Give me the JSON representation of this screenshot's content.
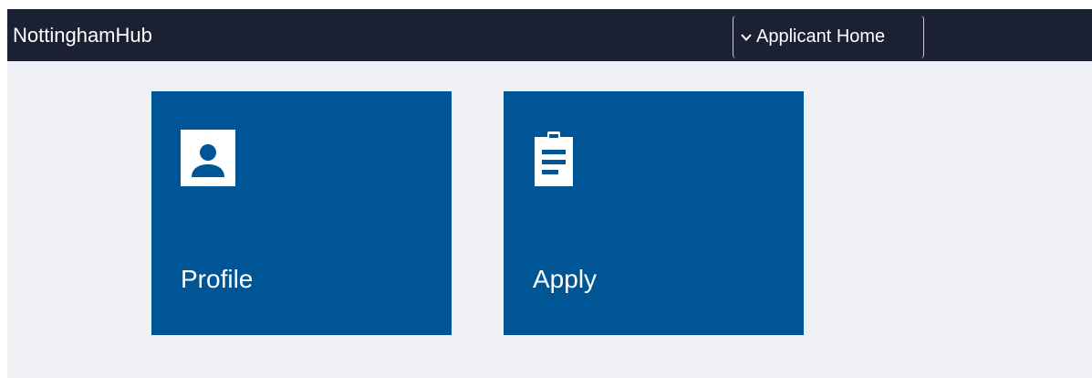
{
  "app": {
    "brand": "NottinghamHub"
  },
  "header": {
    "nav_select_label": "Applicant Home",
    "nav_select_icon": "chevron-down-icon"
  },
  "tiles": [
    {
      "label": "Profile",
      "icon": "person-icon"
    },
    {
      "label": "Apply",
      "icon": "clipboard-icon"
    }
  ],
  "colors": {
    "header_bg": "#1b2132",
    "page_bg": "#eff0f4",
    "tile_bg": "#005597",
    "text_light": "#ffffff"
  }
}
